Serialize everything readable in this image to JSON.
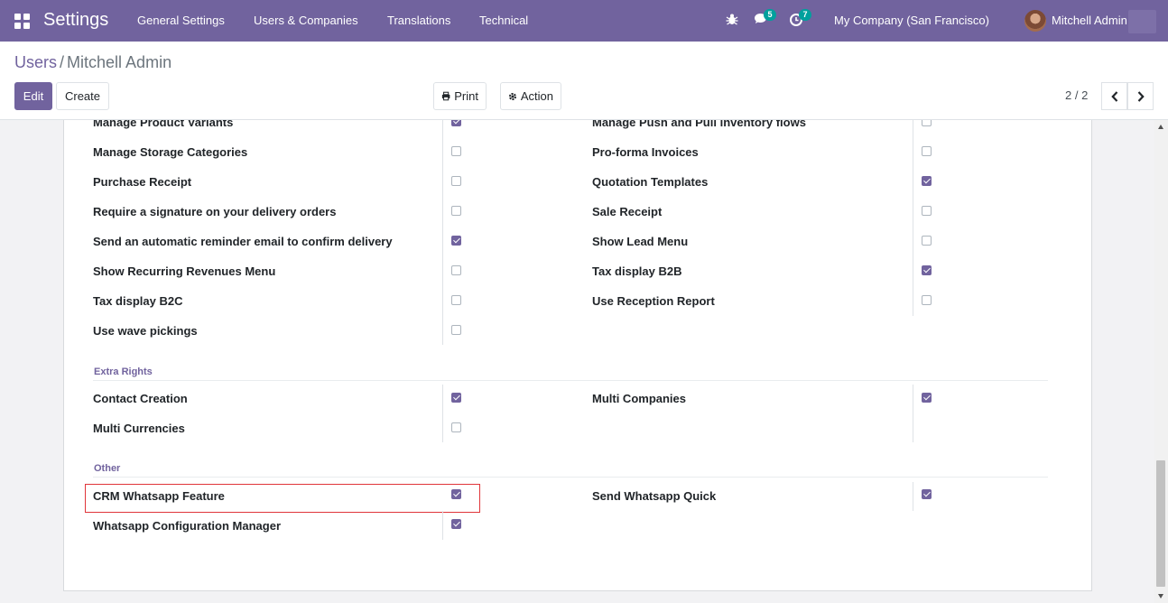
{
  "navbar": {
    "brand": "Settings",
    "menu": [
      "General Settings",
      "Users & Companies",
      "Translations",
      "Technical"
    ],
    "messages_count": "5",
    "activities_count": "7",
    "company": "My Company (San Francisco)",
    "user": "Mitchell Admin"
  },
  "breadcrumb": {
    "parent": "Users",
    "separator": "/",
    "current": "Mitchell Admin"
  },
  "toolbar": {
    "edit": "Edit",
    "create": "Create",
    "print": "Print",
    "action": "Action",
    "pager": "2 / 2"
  },
  "rights_left": [
    {
      "label": "Manage Product Variants",
      "checked": true
    },
    {
      "label": "Manage Storage Categories",
      "checked": false
    },
    {
      "label": "Purchase Receipt",
      "checked": false
    },
    {
      "label": "Require a signature on your delivery orders",
      "checked": false
    },
    {
      "label": "Send an automatic reminder email to confirm delivery",
      "checked": true
    },
    {
      "label": "Show Recurring Revenues Menu",
      "checked": false
    },
    {
      "label": "Tax display B2C",
      "checked": false
    },
    {
      "label": "Use wave pickings",
      "checked": false
    }
  ],
  "rights_right": [
    {
      "label": "Manage Push and Pull inventory flows",
      "checked": false
    },
    {
      "label": "Pro-forma Invoices",
      "checked": false
    },
    {
      "label": "Quotation Templates",
      "checked": true
    },
    {
      "label": "Sale Receipt",
      "checked": false
    },
    {
      "label": "Show Lead Menu",
      "checked": false
    },
    {
      "label": "Tax display B2B",
      "checked": true
    },
    {
      "label": "Use Reception Report",
      "checked": false
    }
  ],
  "extra_rights": {
    "title": "Extra Rights",
    "left": [
      {
        "label": "Contact Creation",
        "checked": true
      },
      {
        "label": "Multi Currencies",
        "checked": false
      }
    ],
    "right": [
      {
        "label": "Multi Companies",
        "checked": true
      }
    ]
  },
  "other": {
    "title": "Other",
    "left": [
      {
        "label": "CRM Whatsapp Feature",
        "checked": true
      },
      {
        "label": "Whatsapp Configuration Manager",
        "checked": true
      }
    ],
    "right": [
      {
        "label": "Send Whatsapp Quick",
        "checked": true
      }
    ]
  },
  "colors": {
    "brand": "#71639e",
    "badge": "#00a09d",
    "highlight": "#e0353a"
  }
}
